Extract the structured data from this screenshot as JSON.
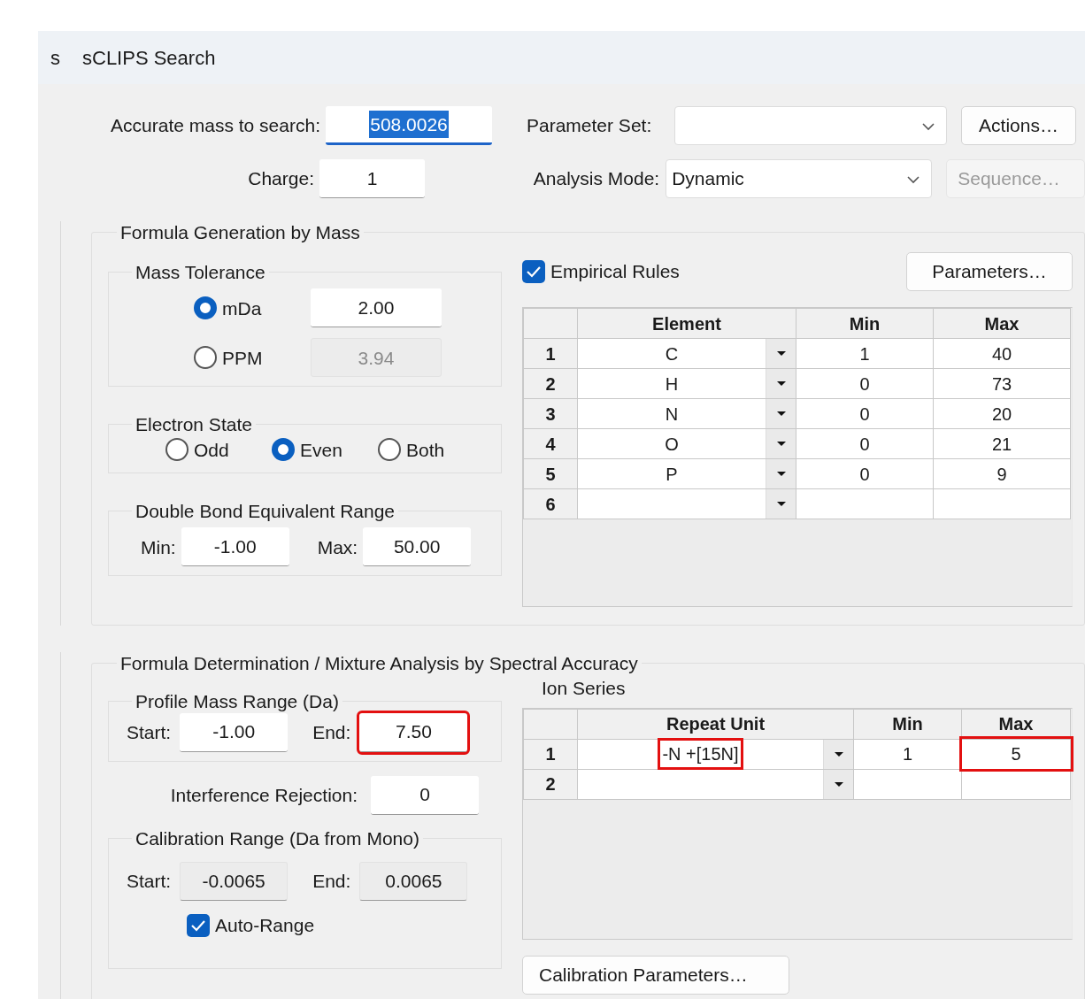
{
  "window": {
    "title_fragment": "s",
    "title": "sCLIPS Search"
  },
  "search": {
    "mass_label": "Accurate mass to search:",
    "mass_value": "508.0026",
    "mass_text_selected": true,
    "charge_label": "Charge:",
    "charge_value": "1",
    "parameter_set_label": "Parameter Set:",
    "analysis_mode_label": "Analysis Mode:",
    "analysis_mode_value": "Dynamic",
    "actions_button": {
      "label": "Actions…",
      "disabled": false
    },
    "sequence_button": {
      "label": "Sequence…",
      "disabled": true
    }
  },
  "formula_generation": {
    "title": "Formula Generation by Mass",
    "mass_tolerance": {
      "title": "Mass Tolerance",
      "options": [
        {
          "label": "mDa",
          "selected": true,
          "value": "2.00",
          "disabled": false
        },
        {
          "label": "PPM",
          "selected": false,
          "value": "3.94",
          "disabled": true
        }
      ]
    },
    "electron_state": {
      "title": "Electron State",
      "options": [
        {
          "label": "Odd",
          "selected": false
        },
        {
          "label": "Even",
          "selected": true
        },
        {
          "label": "Both",
          "selected": false
        }
      ]
    },
    "dbe_range": {
      "title": "Double Bond Equivalent Range",
      "min_label": "Min:",
      "min_value": "-1.00",
      "max_label": "Max:",
      "max_value": "50.00"
    },
    "empirical_rules": {
      "label": "Empirical Rules",
      "checked": true
    },
    "parameters_button": "Parameters…",
    "element_table": {
      "columns": [
        "Element",
        "Min",
        "Max"
      ],
      "rows": [
        {
          "index": "1",
          "element": "C",
          "min": "1",
          "max": "40"
        },
        {
          "index": "2",
          "element": "H",
          "min": "0",
          "max": "73"
        },
        {
          "index": "3",
          "element": "N",
          "min": "0",
          "max": "20"
        },
        {
          "index": "4",
          "element": "O",
          "min": "0",
          "max": "21"
        },
        {
          "index": "5",
          "element": "P",
          "min": "0",
          "max": "9"
        },
        {
          "index": "6"
        }
      ]
    }
  },
  "formula_determination": {
    "title": "Formula Determination / Mixture Analysis by Spectral Accuracy",
    "profile_mass_range": {
      "title": "Profile Mass Range (Da)",
      "start_label": "Start:",
      "start_value": "-1.00",
      "end_label": "End:",
      "end_value": "7.50",
      "end_highlighted": true
    },
    "interference": {
      "label": "Interference Rejection:",
      "value": "0"
    },
    "calibration_range": {
      "title": "Calibration Range (Da from Mono)",
      "start_label": "Start:",
      "start_value": "-0.0065",
      "end_label": "End:",
      "end_value": "0.0065",
      "readonly": true,
      "auto_range": {
        "label": "Auto-Range",
        "checked": true
      }
    },
    "ion_series": {
      "title": "Ion Series",
      "columns": [
        "Repeat Unit",
        "Min",
        "Max"
      ],
      "rows": [
        {
          "index": "1",
          "repeat_unit": "-N +[15N]",
          "min": "1",
          "max": "5",
          "repeat_unit_highlighted": true,
          "max_highlighted": true
        },
        {
          "index": "2"
        }
      ]
    },
    "calibration_button": "Calibration Parameters…"
  }
}
